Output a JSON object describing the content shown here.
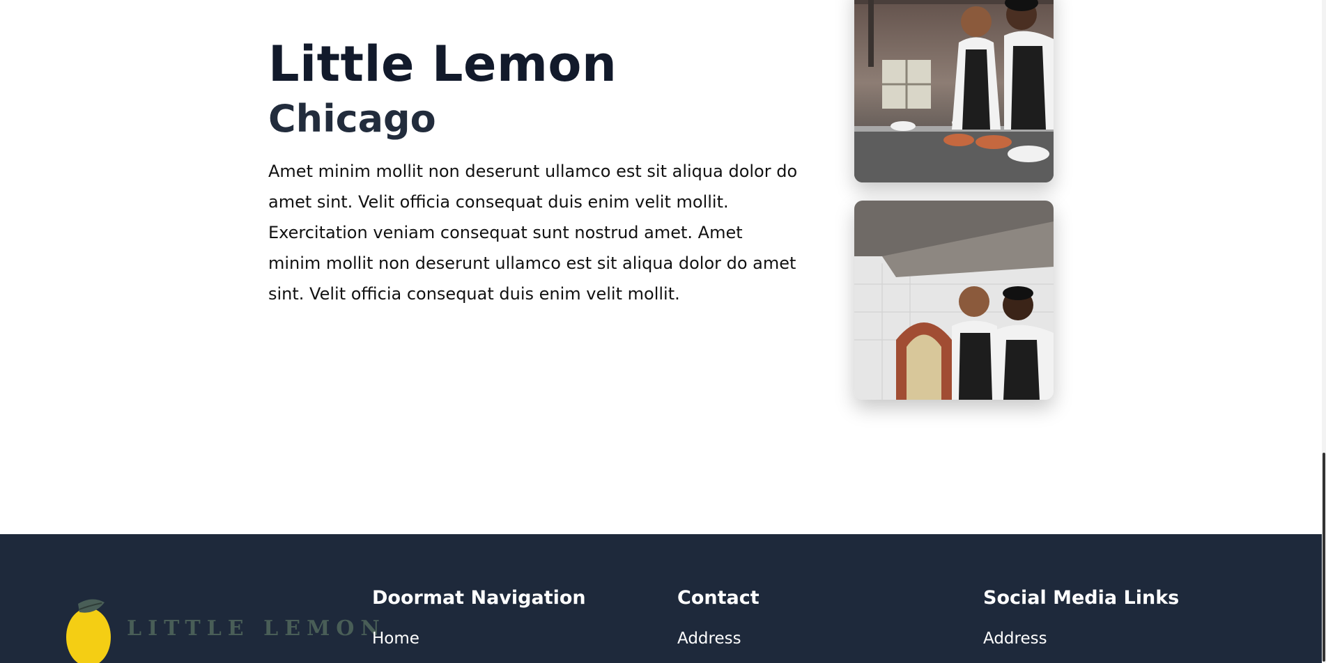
{
  "about": {
    "title": "Little Lemon",
    "subtitle": "Chicago",
    "body": "Amet minim mollit non deserunt ullamco est sit aliqua dolor do amet sint. Velit officia consequat duis enim velit mollit. Exercitation veniam consequat sunt nostrud amet. Amet minim mollit non deserunt ullamco est sit aliqua dolor do amet sint. Velit officia consequat duis enim velit mollit."
  },
  "footer": {
    "logo_text": "LITTLE LEMON",
    "columns": [
      {
        "heading": "Doormat Navigation",
        "links": [
          "Home"
        ]
      },
      {
        "heading": "Contact",
        "links": [
          "Address"
        ]
      },
      {
        "heading": "Social Media Links",
        "links": [
          "Address"
        ]
      }
    ]
  },
  "colors": {
    "footer_bg": "#1e293b",
    "heading_text": "#121a2b",
    "logo_green": "#495e57",
    "lemon_yellow": "#f4ce14"
  },
  "icons": {
    "logo": "lemon-logo-icon"
  }
}
